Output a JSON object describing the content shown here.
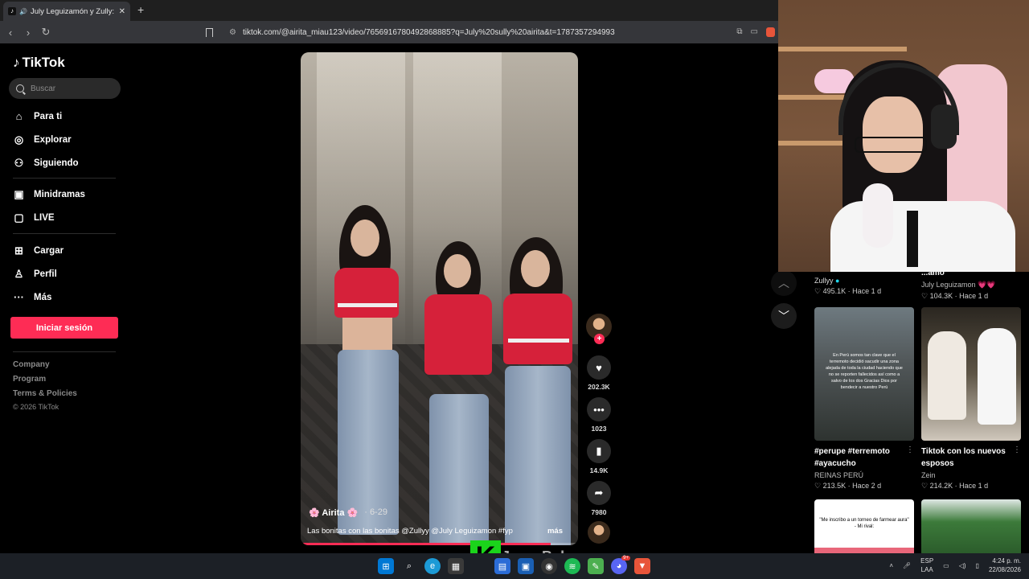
{
  "browser": {
    "tab_title": "July Leguizamón y Zully: las b",
    "tab_close": "✕",
    "new_tab": "+",
    "url": "tiktok.com/@airita_miau123/video/7656916780492868885?q=July%20sully%20airita&t=1787357294993"
  },
  "sidebar": {
    "logo": "TikTok",
    "search_placeholder": "Buscar",
    "nav": [
      {
        "label": "Para ti",
        "icon": "home-icon"
      },
      {
        "label": "Explorar",
        "icon": "compass-icon"
      },
      {
        "label": "Siguiendo",
        "icon": "following-icon"
      },
      {
        "label": "Minidramas",
        "icon": "minidramas-icon"
      },
      {
        "label": "LIVE",
        "icon": "live-icon"
      },
      {
        "label": "Cargar",
        "icon": "upload-icon"
      },
      {
        "label": "Perfil",
        "icon": "profile-icon"
      },
      {
        "label": "Más",
        "icon": "more-icon"
      }
    ],
    "login_button": "Iniciar sesión",
    "footer": [
      "Company",
      "Program",
      "Terms & Policies"
    ],
    "copyright": "© 2026 TikTok"
  },
  "video": {
    "author": "🌸 Airita 🌸",
    "date": "· 6-29",
    "caption": "Las bonitas con las bonitas @Zullyy  @July Leguizamon  #fyp",
    "more": "más",
    "progress": 0.9,
    "likes": "202.3K",
    "comments": "1023",
    "saves": "14.9K",
    "shares": "7980"
  },
  "recommendations": {
    "top_left": {
      "author": "Zullyy",
      "likes": "495.1K",
      "age": "Hace 1 d"
    },
    "top_right": {
      "title": "...amo",
      "author": "July Leguizamon 💗💗",
      "likes": "104.3K",
      "age": "Hace 1 d"
    },
    "card1": {
      "title": "#perupe #terremoto #ayacucho",
      "author": "REINAS PERÚ",
      "likes": "213.5K",
      "age": "Hace 2 d",
      "thumb_text": "En Perú somos tan clave que el terremoto decidió sacudir una zona alejada de toda la ciudad haciendo que no se reporten fallecidos así como a salvo de los dos Gracias Dios por bendecir a nuestro Perú"
    },
    "card2": {
      "title": "Tiktok con los nuevos esposos",
      "author": "Zein",
      "likes": "214.2K",
      "age": "Hace 1 d"
    },
    "card3": {
      "thumb_text": "\"Me inscribo a un torneo de farmear aura\" - Mi rival:"
    }
  },
  "stream_overlay": {
    "brand_letter": "K",
    "streamer": "JessyBaby"
  },
  "taskbar": {
    "lang_top": "ESP",
    "lang_bottom": "LAA",
    "time": "4:24 p. m.",
    "date": "22/08/2026",
    "discord_badge": "9+"
  },
  "colors": {
    "accent": "#fe2c55",
    "background": "#000000",
    "brand_green": "#1bd41b"
  }
}
